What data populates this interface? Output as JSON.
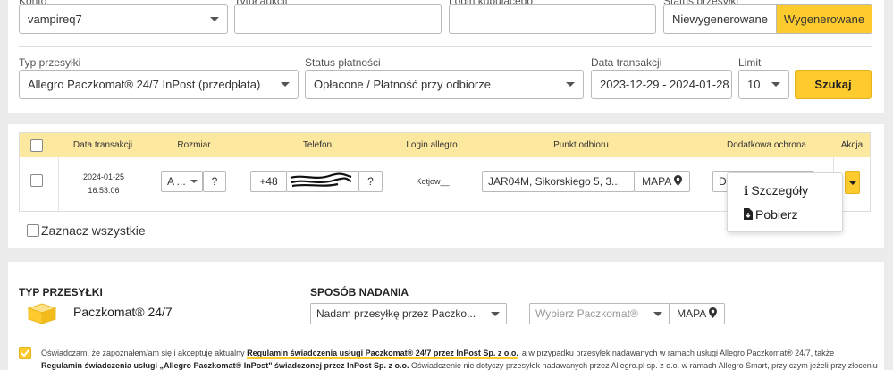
{
  "filters_top": {
    "login_value": "vampireq7",
    "label_title_cut": "Tytuł aukcji",
    "label_login_cut": "Login kupującego",
    "label_status_cut": "Status przesyłki",
    "label_login_cut0": "Konto",
    "toggle_not_generated": "Niewygenerowane",
    "toggle_generated": "Wygenerowane"
  },
  "filters": {
    "type_label": "Typ przesyłki",
    "type_value": "Allegro Paczkomat® 24/7 InPost (przedpłata)",
    "payment_label": "Status płatności",
    "payment_value": "Opłacone / Płatność przy odbiorze",
    "date_label": "Data transakcji",
    "date_value": "2023-12-29 - 2024-01-28",
    "limit_label": "Limit",
    "limit_value": "10",
    "search_button": "Szukaj"
  },
  "table": {
    "headers": [
      "Data transakcji",
      "Rozmiar",
      "Telefon",
      "Login allegro",
      "Punkt odbioru",
      "Dodatkowa ochrona",
      "Akcja"
    ],
    "row": {
      "date": "2024-01-25",
      "time": "16:53:06",
      "size": "A ...",
      "size_help": "?",
      "phone_prefix": "+48",
      "phone_help": "?",
      "login": "Kotjow__",
      "pickup_point": "JAR04M, Sikorskiego 5, 3...",
      "map_label": "MAPA",
      "protection_value": "D"
    },
    "select_all": "Zaznacz wszystkie"
  },
  "action_menu": {
    "details": "Szczegóły",
    "download": "Pobierz"
  },
  "shipment": {
    "type_title": "TYP PRZESYŁKI",
    "type_value": "Paczkomat® 24/7",
    "method_title": "SPOSÓB NADANIA",
    "method_value": "Nadam przesyłkę przez Paczko...",
    "locker_placeholder": "Wybierz Paczkomat®",
    "map_label": "MAPA"
  },
  "consent": {
    "line1_a": "Oświadczam, że zapoznałem/am się i akceptuję aktualny",
    "line1_link": "Regulamin świadczenia usługi Paczkomat® 24/7 przez InPost Sp. z o.o.",
    "line1_b": "a w przypadku przesyłek nadawanych w ramach usługi Allegro Paczkomat® 24/7, także",
    "line2_link": "Regulamin świadczenia usługi „Allegro Paczkomat® InPost\" świadczonej przez InPost Sp. z o.o.",
    "line2_b": "Oświadczenie nie dotyczy przesyłek nadawanych przez Allegro.pl sp. z o.o. w ramach Allegro Smart, przy czym jeżeli przy złoceniu"
  },
  "colors": {
    "accent": "#fdcb2e",
    "header_row": "#fde8a0"
  }
}
